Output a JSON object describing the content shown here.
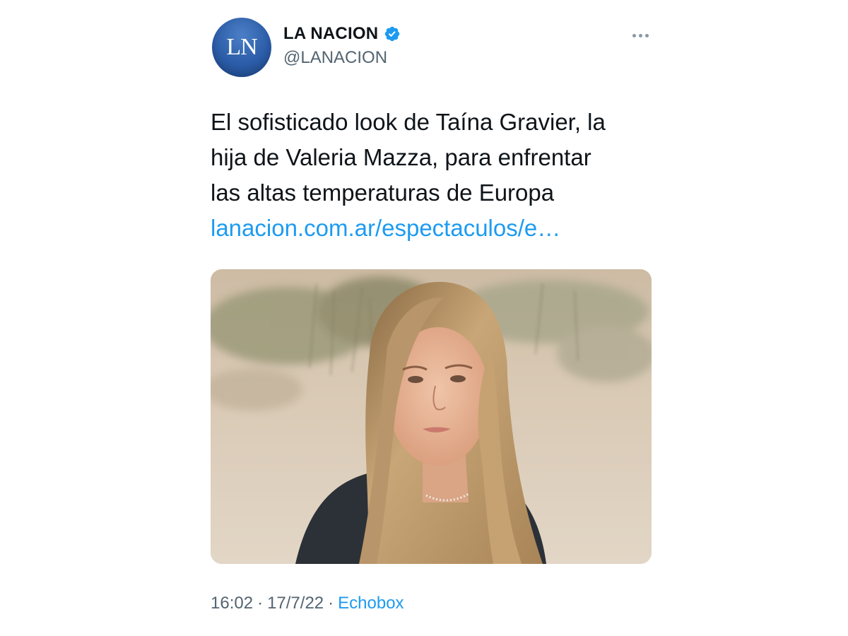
{
  "account": {
    "avatar_text": "LN",
    "display_name": "LA NACION",
    "handle": "@LANACION",
    "verified": true,
    "verified_icon": "verified-badge-icon"
  },
  "menu": {
    "icon": "more-options-icon"
  },
  "tweet": {
    "lines": [
      "El sofisticado look de Taína Gravier, la",
      "hija de Valeria Mazza, para enfrentar",
      "las altas temperaturas de Europa"
    ],
    "link": "lanacion.com.ar/espectaculos/e…"
  },
  "meta": {
    "time": "16:02",
    "separator": "·",
    "date": "17/7/22",
    "source": "Echobox"
  },
  "colors": {
    "text": "#0f1419",
    "secondary": "#536471",
    "link": "#1d9bf0",
    "avatar": "#2c5da8"
  }
}
